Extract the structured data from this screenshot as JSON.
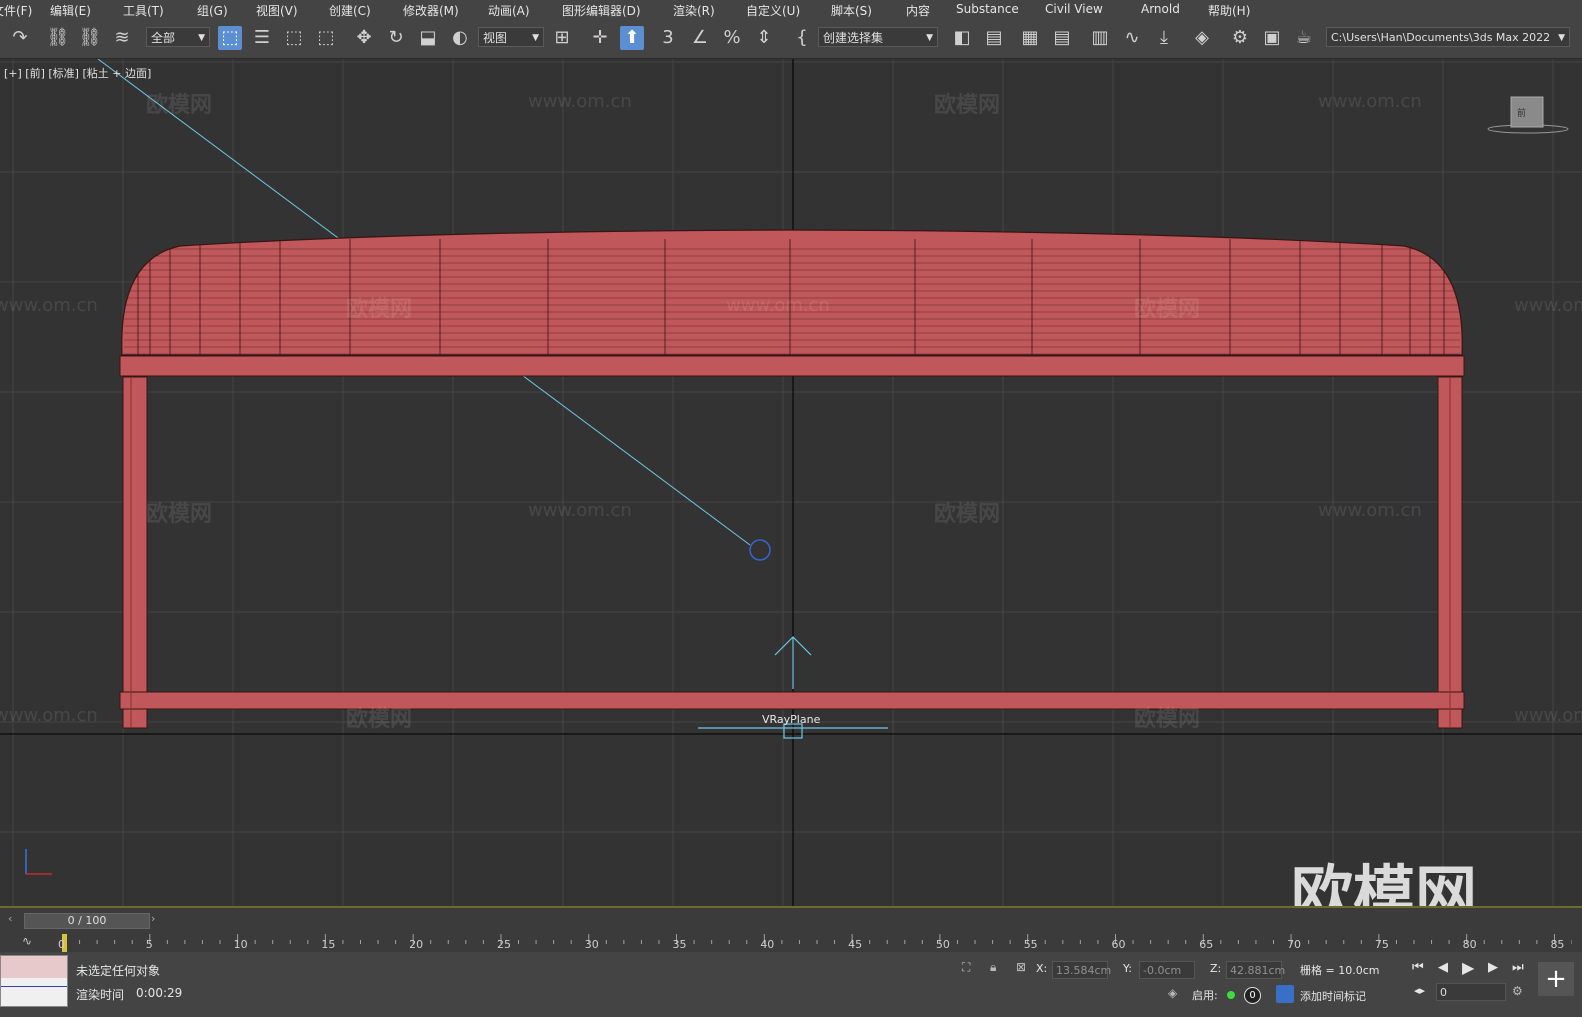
{
  "menu": {
    "items": [
      "文件(F)",
      "编辑(E)",
      "工具(T)",
      "组(G)",
      "视图(V)",
      "创建(C)",
      "修改器(M)",
      "动画(A)",
      "图形编辑器(D)",
      "渲染(R)",
      "自定义(U)",
      "脚本(S)",
      "内容",
      "Substance",
      "Civil View",
      "Arnold",
      "帮助(H)"
    ]
  },
  "toolbar": {
    "selection_filter": "全部",
    "reference_coord": "视图",
    "named_selection": "创建选择集",
    "project_path": "C:\\Users\\Han\\Documents\\3ds Max 2022",
    "snap_label": "3"
  },
  "viewport": {
    "label": "[+] [前] [标准] [粘土 + 边面]",
    "object_label": "VRayPlane",
    "viewcube_label": "前",
    "watermark_text": "欧模网",
    "watermark_url": "www.om.cn",
    "brand_watermark": "欧模网",
    "colors": {
      "mesh": "#c0575a",
      "mesh_edge": "#3a1414",
      "light_line": "#6ec6e6",
      "axis_line": "#0a0a0a"
    }
  },
  "timeline": {
    "frame_display": "0 / 100",
    "ruler_labels": [
      "0",
      "5",
      "10",
      "15",
      "20",
      "25",
      "30",
      "35",
      "40",
      "45",
      "50",
      "55",
      "60",
      "65",
      "70",
      "75",
      "80",
      "85"
    ]
  },
  "status": {
    "selection_text": "未选定任何对象",
    "render_time_label": "渲染时间",
    "render_time_value": "0:00:29",
    "x_label": "X:",
    "x_value": "13.584cm",
    "y_label": "Y:",
    "y_value": "-0.0cm",
    "z_label": "Z:",
    "z_value": "42.881cm",
    "grid_text": "栅格 = 10.0cm",
    "enable_label": "启用:",
    "enable_count": "0",
    "add_time_tag": "添加时间标记",
    "frame_input": "0"
  }
}
